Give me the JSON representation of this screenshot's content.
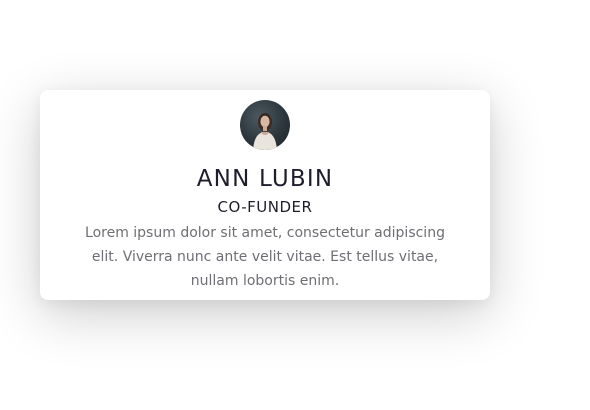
{
  "profile": {
    "name": "ANN LUBIN",
    "role": "CO-FUNDER",
    "bio": "Lorem ipsum dolor sit amet, consectetur adipiscing elit. Viverra nunc ante velit vitae. Est tellus vitae, nullam lobortis enim.",
    "avatar_icon": "person-photo",
    "colors": {
      "name": "#1f1d2b",
      "bio": "#6f6e74",
      "card": "#ffffff"
    }
  }
}
